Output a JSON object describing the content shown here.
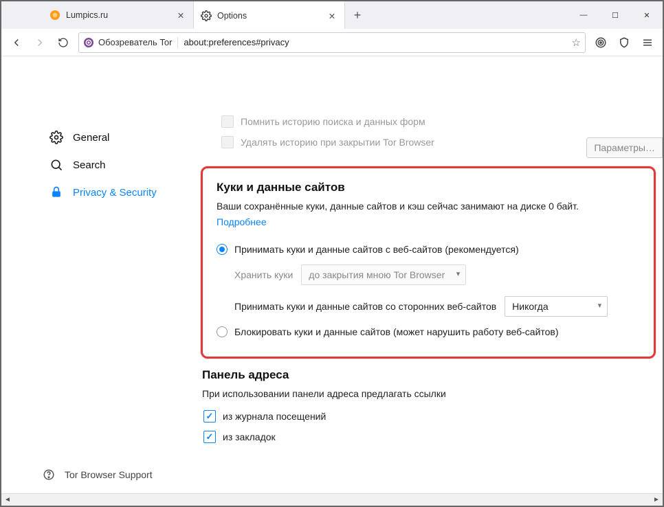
{
  "window": {
    "minimize": "—",
    "maximize": "☐",
    "close": "✕"
  },
  "tabs": {
    "items": [
      {
        "label": "Lumpics.ru",
        "icon": "orange-circle"
      },
      {
        "label": "Options",
        "icon": "gear"
      }
    ],
    "active_index": 1,
    "newtab": "+"
  },
  "urlbar": {
    "identity_label": "Обозреватель Tor",
    "url": "about:preferences#privacy"
  },
  "sidebar": {
    "items": [
      {
        "label": "General",
        "icon": "gear"
      },
      {
        "label": "Search",
        "icon": "search"
      },
      {
        "label": "Privacy & Security",
        "icon": "lock"
      }
    ],
    "active_index": 2,
    "support": {
      "label": "Tor Browser Support",
      "icon": "question"
    }
  },
  "history": {
    "remember_forms_label": "Помнить историю поиска и данных форм",
    "clear_on_close_label": "Удалять историю при закрытии Tor Browser",
    "params_button": "Параметры"
  },
  "cookies": {
    "title": "Куки и данные сайтов",
    "desc": "Ваши сохранённые куки, данные сайтов и кэш сейчас занимают на диске 0 байт.",
    "learn_more": "Подробнее",
    "accept_label": "Принимать куки и данные сайтов с веб-сайтов (рекомендуется)",
    "keep_label": "Хранить куки",
    "keep_value": "до закрытия мною Tor Browser",
    "third_party_label": "Принимать куки и данные сайтов со сторонних веб-сайтов",
    "third_party_value": "Никогда",
    "block_label": "Блокировать куки и данные сайтов (может нарушить работу веб-сайтов)",
    "selected": "accept"
  },
  "addressbar": {
    "title": "Панель адреса",
    "desc": "При использовании панели адреса предлагать ссылки",
    "history_label": "из журнала посещений",
    "bookmarks_label": "из закладок"
  }
}
